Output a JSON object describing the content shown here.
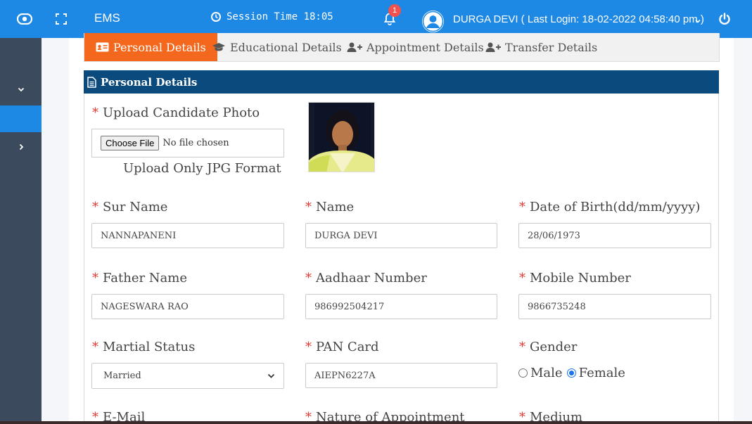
{
  "header": {
    "app_title": "EMS",
    "session_text": "Session Time 18:05",
    "notification_count": "1",
    "user_text": "DURGA DEVI ( Last Login: 18-02-2022 04:58:40 pm )",
    "nav_color": "#1e88e5"
  },
  "tabs": [
    {
      "label": "Personal Details",
      "icon": "id-card-icon",
      "active": true
    },
    {
      "label": "Educational Details",
      "icon": "graduation-cap-icon",
      "active": false
    },
    {
      "label": "Appointment Details",
      "icon": "user-plus-icon",
      "active": false
    },
    {
      "label": "Transfer Details",
      "icon": "user-plus-icon",
      "active": false
    }
  ],
  "panel": {
    "title": "Personal Details"
  },
  "form": {
    "photo_label": "Upload Candidate Photo",
    "file_button": "Choose File",
    "file_status": "No file chosen",
    "photo_hint": "Upload Only JPG Format",
    "surname_label": "Sur Name",
    "surname_value": "NANNAPANENI",
    "name_label": "Name",
    "name_value": "DURGA DEVI",
    "dob_label": "Date of Birth(dd/mm/yyyy)",
    "dob_value": "28/06/1973",
    "father_label": "Father Name",
    "father_value": "NAGESWARA RAO",
    "aadhaar_label": "Aadhaar Number",
    "aadhaar_value": "986992504217",
    "mobile_label": "Mobile Number",
    "mobile_value": "9866735248",
    "marital_label": "Martial Status",
    "marital_value": "Married",
    "pan_label": "PAN Card",
    "pan_value": "AIEPN6227A",
    "gender_label": "Gender",
    "gender_male": "Male",
    "gender_female": "Female",
    "gender_selected": "Female",
    "email_label": "E-Mail",
    "appointment_label": "Nature of Appointment",
    "medium_label": "Medium",
    "required_mark": "*"
  }
}
